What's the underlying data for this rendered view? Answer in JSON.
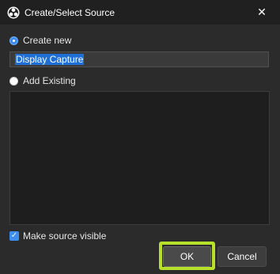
{
  "dialog": {
    "title": "Create/Select Source",
    "close_label": "✕"
  },
  "options": {
    "create_new_label": "Create new",
    "create_new_selected": true,
    "source_name_value": "Display Capture",
    "add_existing_label": "Add Existing",
    "add_existing_selected": false
  },
  "visibility": {
    "label": "Make source visible",
    "checked": true
  },
  "buttons": {
    "ok_label": "OK",
    "cancel_label": "Cancel"
  },
  "colors": {
    "highlight": "#b6e02a",
    "accent": "#3d8ef0"
  }
}
